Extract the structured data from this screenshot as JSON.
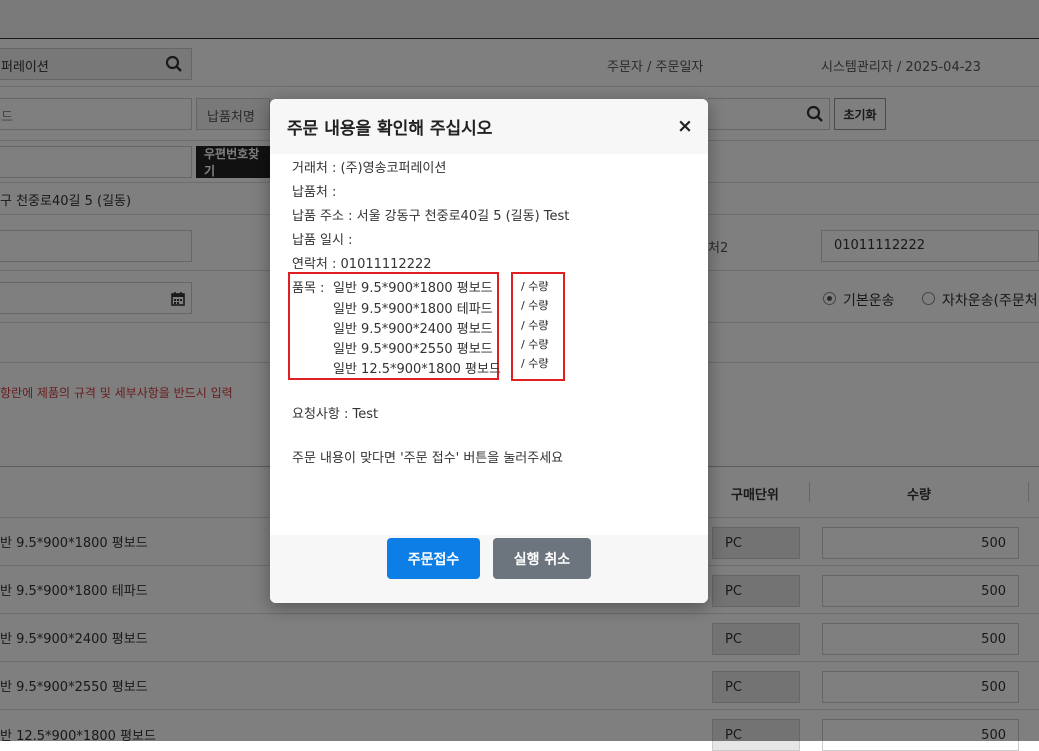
{
  "background": {
    "partner_field": "퍼레이션",
    "orderer_label": "주문자 / 주문일자",
    "orderer_value": "시스템관리자 / 2025-04-23",
    "code_field": "드",
    "delivery_label": "납품처명",
    "reset_button": "초기화",
    "postcode_button": "우편번호찾기",
    "address_text": "구 천중로40길 5 (길동)",
    "contact2_label": "처2",
    "contact2_value": "01011112222",
    "shipping_basic": "기본운송",
    "shipping_self": "자차운송(주문처",
    "warning_text": "항란에 제품의 규격 및 세부사항을 반드시 입력",
    "table_headers": {
      "unit": "구매단위",
      "qty": "수량"
    },
    "rows": [
      {
        "name": "반 9.5*900*1800 평보드",
        "unit": "PC",
        "qty": "500"
      },
      {
        "name": "반 9.5*900*1800 테파드",
        "unit": "PC",
        "qty": "500"
      },
      {
        "name": "반 9.5*900*2400 평보드",
        "unit": "PC",
        "qty": "500"
      },
      {
        "name": "반 9.5*900*2550 평보드",
        "unit": "PC",
        "qty": "500"
      },
      {
        "name": "반 12.5*900*1800 평보드",
        "unit": "PC",
        "qty": "500"
      }
    ]
  },
  "modal": {
    "title": "주문 내용을 확인해 주십시오",
    "close": "×",
    "lines": {
      "partner": "거래처 : (주)영송코퍼레이션",
      "delivery": "납품처 :",
      "address": "납품 주소 : 서울 강동구 천중로40길 5 (길동) Test",
      "datetime": "납품 일시 :",
      "contact": "연락처 : 01011112222"
    },
    "items_label": "품목 :",
    "items": [
      "일반 9.5*900*1800 평보드",
      "일반 9.5*900*1800 테파드",
      "일반 9.5*900*2400 평보드",
      "일반 9.5*900*2550 평보드",
      "일반 12.5*900*1800 평보드"
    ],
    "qty_labels": [
      "/ 수량",
      "/ 수량",
      "/ 수량",
      "/ 수량",
      "/ 수량"
    ],
    "request": "요청사항 : Test",
    "confirm_text": "주문 내용이 맞다면 '주문 접수' 버튼을 눌러주세요",
    "submit_button": "주문접수",
    "cancel_button": "실행 취소"
  },
  "colors": {
    "primary": "#0d7ee6",
    "secondary": "#6c757d",
    "highlight": "#e02020",
    "warning": "#d23c3c"
  },
  "icons": [
    "search-icon",
    "calendar-icon",
    "close-icon"
  ]
}
